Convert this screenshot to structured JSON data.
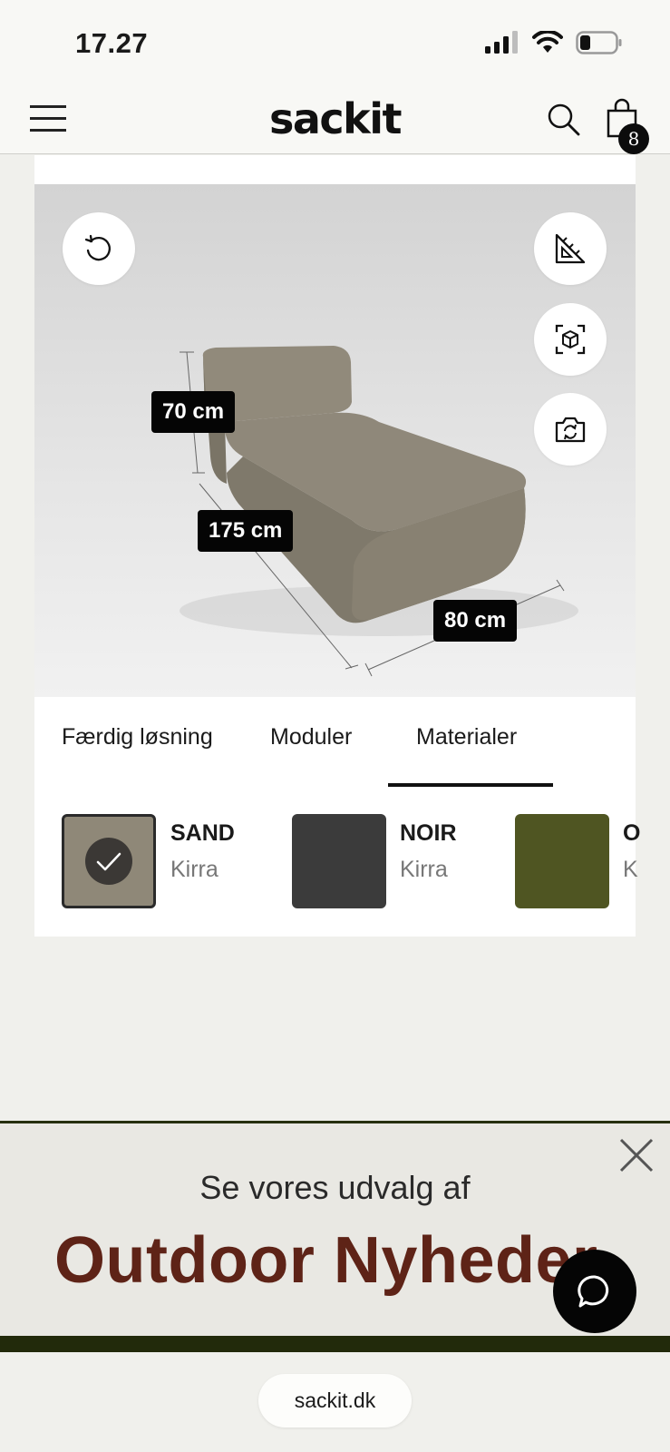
{
  "status_bar": {
    "time": "17.27",
    "battery_icon": "battery-low-icon",
    "wifi_icon": "wifi-icon",
    "signal_icon": "cellular-signal-icon"
  },
  "header": {
    "logo": "sackit",
    "cart_count": "8",
    "icons": [
      "menu-icon",
      "search-icon",
      "shopping-bag-icon"
    ]
  },
  "viewer": {
    "dimensions": {
      "height": "70 cm",
      "length": "175 cm",
      "width": "80 cm"
    },
    "buttons": [
      "rotate-reset-icon",
      "ruler-measure-icon",
      "ar-cube-icon",
      "camera-switch-icon"
    ]
  },
  "tabs": [
    {
      "label": "Færdig løsning",
      "active": false
    },
    {
      "label": "Moduler",
      "active": false
    },
    {
      "label": "Materialer",
      "active": true
    }
  ],
  "materials": [
    {
      "name": "SAND",
      "fabric": "Kirra",
      "color": "#8f8878",
      "selected": true
    },
    {
      "name": "NOIR",
      "fabric": "Kirra",
      "color": "#3b3b3b",
      "selected": false
    },
    {
      "name": "O",
      "fabric": "K",
      "color": "#4f5522",
      "selected": false
    }
  ],
  "banner": {
    "subtitle": "Se vores udvalg af",
    "title": "Outdoor Nyheder",
    "title_color": "#5e2317"
  },
  "browser": {
    "url": "sackit.dk"
  }
}
